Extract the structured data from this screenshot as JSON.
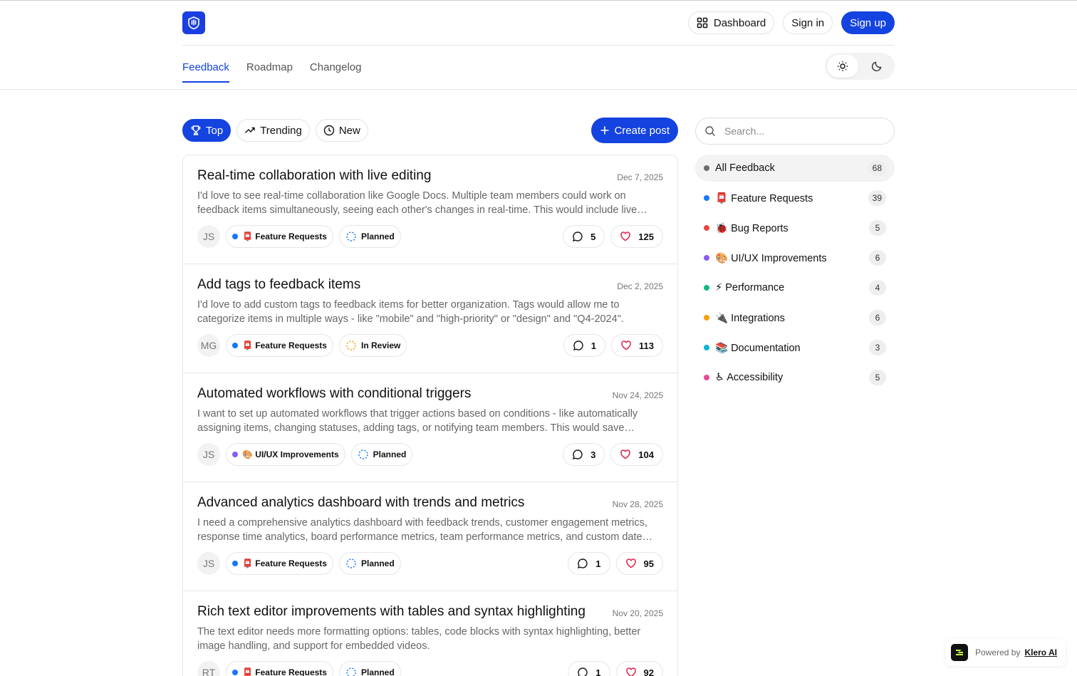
{
  "header": {
    "dashboard_label": "Dashboard",
    "signin_label": "Sign in",
    "signup_label": "Sign up"
  },
  "nav": {
    "tabs": [
      {
        "label": "Feedback",
        "active": true
      },
      {
        "label": "Roadmap",
        "active": false
      },
      {
        "label": "Changelog",
        "active": false
      }
    ]
  },
  "filters": {
    "top": "Top",
    "trending": "Trending",
    "new": "New",
    "create_post": "Create post"
  },
  "posts": [
    {
      "title": "Real-time collaboration with live editing",
      "date": "Dec 7, 2025",
      "description": "I'd love to see real-time collaboration like Google Docs. Multiple team members could work on feedback items simultaneously, seeing each other's changes in real-time. This would include live cursors, presence indicators, and conflict resolution.",
      "author": "JS",
      "category": "📮 Feature Requests",
      "category_color": "#1677ff",
      "status": "Planned",
      "status_color": "#1677ff",
      "comments": "5",
      "likes": "125"
    },
    {
      "title": "Add tags to feedback items",
      "date": "Dec 2, 2025",
      "description": "I'd love to add custom tags to feedback items for better organization. Tags would allow me to categorize items in multiple ways - like \"mobile\" and \"high-priority\" or \"design\" and \"Q4-2024\".",
      "author": "MG",
      "category": "📮 Feature Requests",
      "category_color": "#1677ff",
      "status": "In Review",
      "status_color": "#f59e0b",
      "comments": "1",
      "likes": "113"
    },
    {
      "title": "Automated workflows with conditional triggers",
      "date": "Nov 24, 2025",
      "description": "I want to set up automated workflows that trigger actions based on conditions - like automatically assigning items, changing statuses, adding tags, or notifying team members. This would save significant time on repetitive tasks.",
      "author": "JS",
      "category": "🎨 UI/UX Improvements",
      "category_color": "#8b5cf6",
      "status": "Planned",
      "status_color": "#1677ff",
      "comments": "3",
      "likes": "104"
    },
    {
      "title": "Advanced analytics dashboard with trends and metrics",
      "date": "Nov 28, 2025",
      "description": "I need a comprehensive analytics dashboard with feedback trends, customer engagement metrics, response time analytics, board performance metrics, team performance metrics, and custom date ranges.",
      "author": "JS",
      "category": "📮 Feature Requests",
      "category_color": "#1677ff",
      "status": "Planned",
      "status_color": "#1677ff",
      "comments": "1",
      "likes": "95"
    },
    {
      "title": "Rich text editor improvements with tables and syntax highlighting",
      "date": "Nov 20, 2025",
      "description": "The text editor needs more formatting options: tables, code blocks with syntax highlighting, better image handling, and support for embedded videos.",
      "author": "RT",
      "category": "📮 Feature Requests",
      "category_color": "#1677ff",
      "status": "Planned",
      "status_color": "#1677ff",
      "comments": "1",
      "likes": "92"
    }
  ],
  "sidebar": {
    "search_placeholder": "Search...",
    "categories": [
      {
        "label": "All Feedback",
        "count": "68",
        "color": "#6b6b6b",
        "active": true
      },
      {
        "label": "📮 Feature Requests",
        "count": "39",
        "color": "#1677ff",
        "active": false
      },
      {
        "label": "🐞 Bug Reports",
        "count": "5",
        "color": "#ef4444",
        "active": false
      },
      {
        "label": "🎨 UI/UX Improvements",
        "count": "6",
        "color": "#8b5cf6",
        "active": false
      },
      {
        "label": "⚡ Performance",
        "count": "4",
        "color": "#10b981",
        "active": false
      },
      {
        "label": "🔌 Integrations",
        "count": "6",
        "color": "#f59e0b",
        "active": false
      },
      {
        "label": "📚 Documentation",
        "count": "3",
        "color": "#06b6d4",
        "active": false
      },
      {
        "label": "♿ Accessibility",
        "count": "5",
        "color": "#ec4899",
        "active": false
      }
    ]
  },
  "powered": {
    "prefix": "Powered by",
    "brand": "Klero AI"
  },
  "colors": {
    "accent": "#1443e0"
  }
}
